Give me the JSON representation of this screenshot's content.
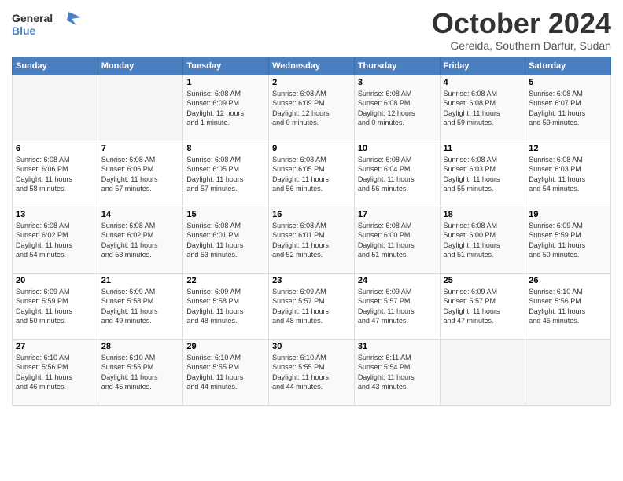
{
  "header": {
    "logo_general": "General",
    "logo_blue": "Blue",
    "title": "October 2024",
    "subtitle": "Gereida, Southern Darfur, Sudan"
  },
  "weekdays": [
    "Sunday",
    "Monday",
    "Tuesday",
    "Wednesday",
    "Thursday",
    "Friday",
    "Saturday"
  ],
  "weeks": [
    [
      {
        "day": "",
        "detail": ""
      },
      {
        "day": "",
        "detail": ""
      },
      {
        "day": "1",
        "detail": "Sunrise: 6:08 AM\nSunset: 6:09 PM\nDaylight: 12 hours\nand 1 minute."
      },
      {
        "day": "2",
        "detail": "Sunrise: 6:08 AM\nSunset: 6:09 PM\nDaylight: 12 hours\nand 0 minutes."
      },
      {
        "day": "3",
        "detail": "Sunrise: 6:08 AM\nSunset: 6:08 PM\nDaylight: 12 hours\nand 0 minutes."
      },
      {
        "day": "4",
        "detail": "Sunrise: 6:08 AM\nSunset: 6:08 PM\nDaylight: 11 hours\nand 59 minutes."
      },
      {
        "day": "5",
        "detail": "Sunrise: 6:08 AM\nSunset: 6:07 PM\nDaylight: 11 hours\nand 59 minutes."
      }
    ],
    [
      {
        "day": "6",
        "detail": "Sunrise: 6:08 AM\nSunset: 6:06 PM\nDaylight: 11 hours\nand 58 minutes."
      },
      {
        "day": "7",
        "detail": "Sunrise: 6:08 AM\nSunset: 6:06 PM\nDaylight: 11 hours\nand 57 minutes."
      },
      {
        "day": "8",
        "detail": "Sunrise: 6:08 AM\nSunset: 6:05 PM\nDaylight: 11 hours\nand 57 minutes."
      },
      {
        "day": "9",
        "detail": "Sunrise: 6:08 AM\nSunset: 6:05 PM\nDaylight: 11 hours\nand 56 minutes."
      },
      {
        "day": "10",
        "detail": "Sunrise: 6:08 AM\nSunset: 6:04 PM\nDaylight: 11 hours\nand 56 minutes."
      },
      {
        "day": "11",
        "detail": "Sunrise: 6:08 AM\nSunset: 6:03 PM\nDaylight: 11 hours\nand 55 minutes."
      },
      {
        "day": "12",
        "detail": "Sunrise: 6:08 AM\nSunset: 6:03 PM\nDaylight: 11 hours\nand 54 minutes."
      }
    ],
    [
      {
        "day": "13",
        "detail": "Sunrise: 6:08 AM\nSunset: 6:02 PM\nDaylight: 11 hours\nand 54 minutes."
      },
      {
        "day": "14",
        "detail": "Sunrise: 6:08 AM\nSunset: 6:02 PM\nDaylight: 11 hours\nand 53 minutes."
      },
      {
        "day": "15",
        "detail": "Sunrise: 6:08 AM\nSunset: 6:01 PM\nDaylight: 11 hours\nand 53 minutes."
      },
      {
        "day": "16",
        "detail": "Sunrise: 6:08 AM\nSunset: 6:01 PM\nDaylight: 11 hours\nand 52 minutes."
      },
      {
        "day": "17",
        "detail": "Sunrise: 6:08 AM\nSunset: 6:00 PM\nDaylight: 11 hours\nand 51 minutes."
      },
      {
        "day": "18",
        "detail": "Sunrise: 6:08 AM\nSunset: 6:00 PM\nDaylight: 11 hours\nand 51 minutes."
      },
      {
        "day": "19",
        "detail": "Sunrise: 6:09 AM\nSunset: 5:59 PM\nDaylight: 11 hours\nand 50 minutes."
      }
    ],
    [
      {
        "day": "20",
        "detail": "Sunrise: 6:09 AM\nSunset: 5:59 PM\nDaylight: 11 hours\nand 50 minutes."
      },
      {
        "day": "21",
        "detail": "Sunrise: 6:09 AM\nSunset: 5:58 PM\nDaylight: 11 hours\nand 49 minutes."
      },
      {
        "day": "22",
        "detail": "Sunrise: 6:09 AM\nSunset: 5:58 PM\nDaylight: 11 hours\nand 48 minutes."
      },
      {
        "day": "23",
        "detail": "Sunrise: 6:09 AM\nSunset: 5:57 PM\nDaylight: 11 hours\nand 48 minutes."
      },
      {
        "day": "24",
        "detail": "Sunrise: 6:09 AM\nSunset: 5:57 PM\nDaylight: 11 hours\nand 47 minutes."
      },
      {
        "day": "25",
        "detail": "Sunrise: 6:09 AM\nSunset: 5:57 PM\nDaylight: 11 hours\nand 47 minutes."
      },
      {
        "day": "26",
        "detail": "Sunrise: 6:10 AM\nSunset: 5:56 PM\nDaylight: 11 hours\nand 46 minutes."
      }
    ],
    [
      {
        "day": "27",
        "detail": "Sunrise: 6:10 AM\nSunset: 5:56 PM\nDaylight: 11 hours\nand 46 minutes."
      },
      {
        "day": "28",
        "detail": "Sunrise: 6:10 AM\nSunset: 5:55 PM\nDaylight: 11 hours\nand 45 minutes."
      },
      {
        "day": "29",
        "detail": "Sunrise: 6:10 AM\nSunset: 5:55 PM\nDaylight: 11 hours\nand 44 minutes."
      },
      {
        "day": "30",
        "detail": "Sunrise: 6:10 AM\nSunset: 5:55 PM\nDaylight: 11 hours\nand 44 minutes."
      },
      {
        "day": "31",
        "detail": "Sunrise: 6:11 AM\nSunset: 5:54 PM\nDaylight: 11 hours\nand 43 minutes."
      },
      {
        "day": "",
        "detail": ""
      },
      {
        "day": "",
        "detail": ""
      }
    ]
  ]
}
